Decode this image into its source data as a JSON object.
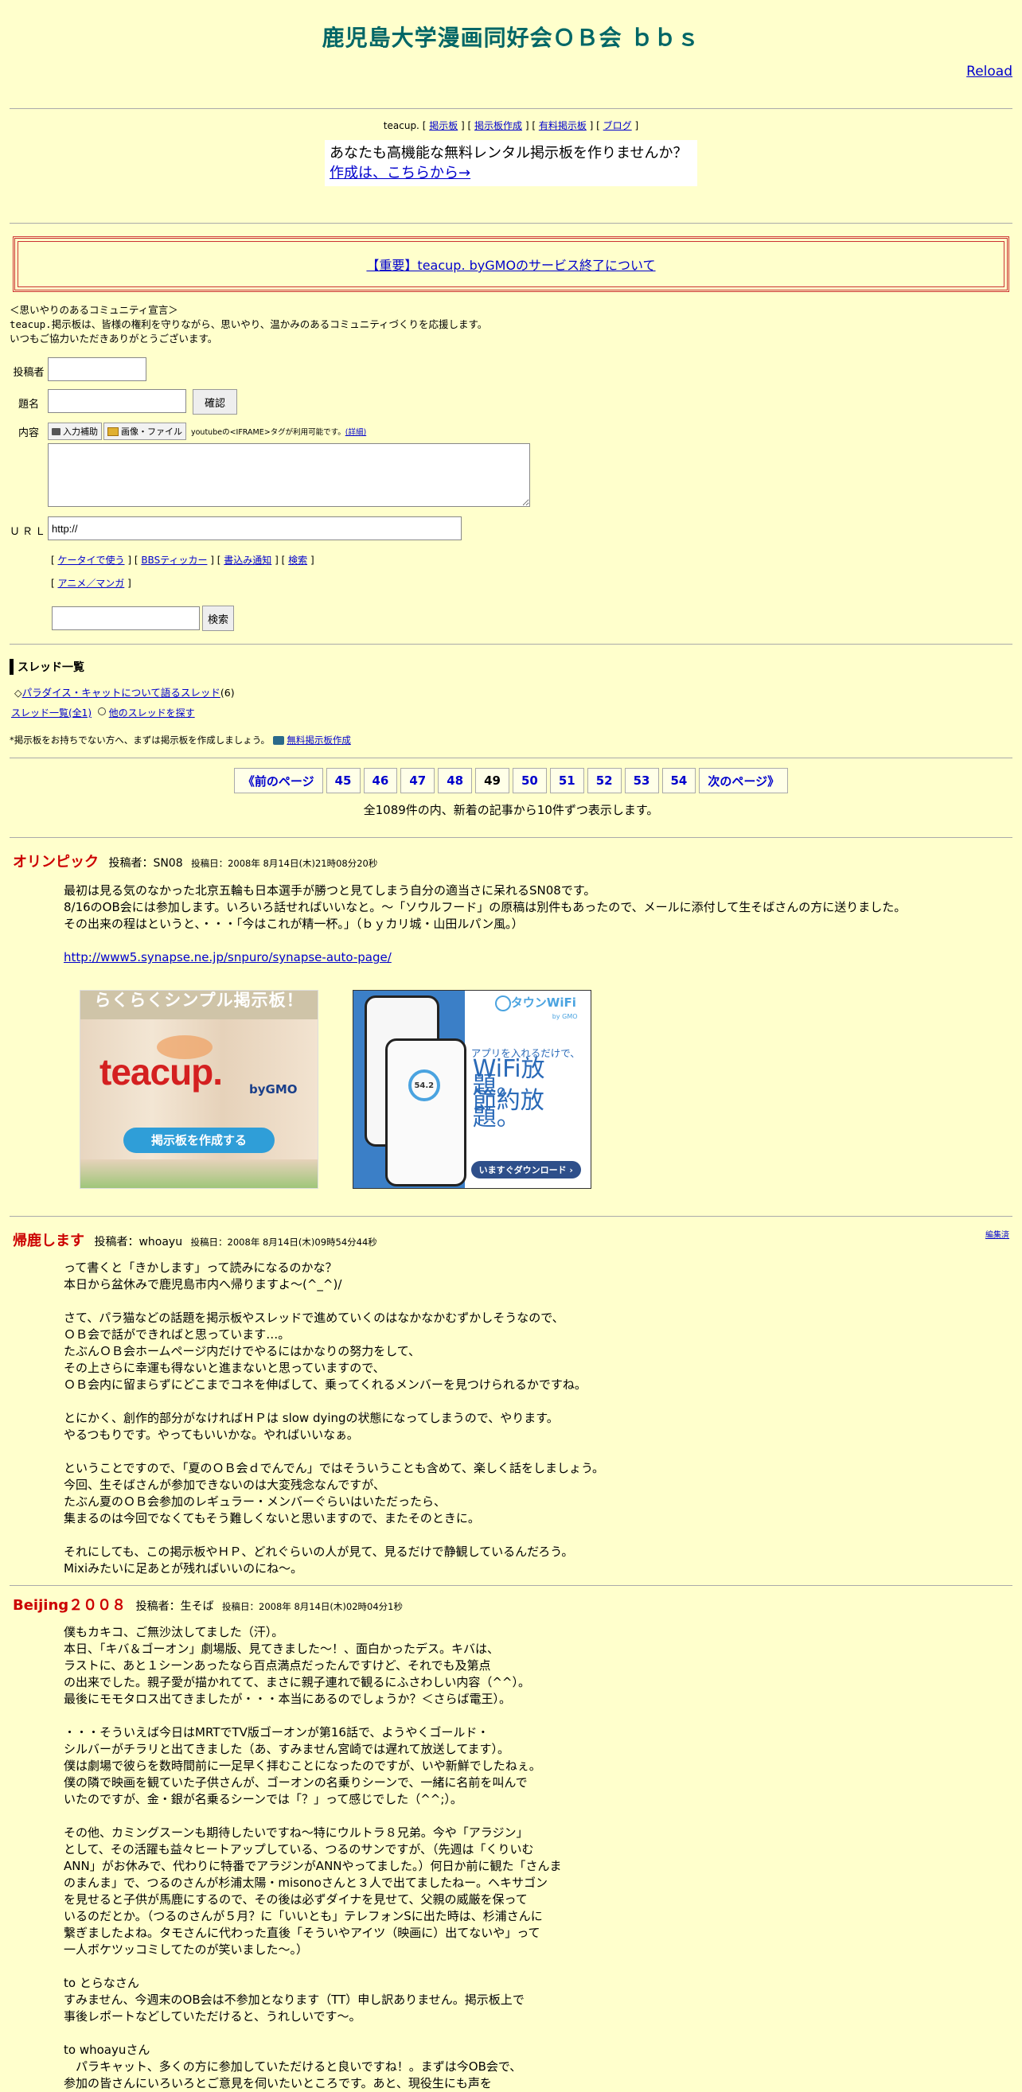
{
  "board": {
    "title": "鹿児島大学漫画同好会ＯＢ会 ｂｂｓ",
    "reload": "Reload"
  },
  "teacup_bar": {
    "prefix": "teacup.",
    "links": [
      "掲示板",
      "掲示板作成",
      "有料掲示板",
      "ブログ"
    ]
  },
  "ad": {
    "line1": "あなたも高機能な無料レンタル掲示板を作りませんか？",
    "link": "作成は、こちらから→"
  },
  "notice": "【重要】teacup. byGMOのサービス終了について",
  "declaration": {
    "line1": "＜思いやりのあるコミュニティ宣言＞",
    "brand": "teacup.",
    "line2": "掲示板は、皆様の権利を守りながら、思いやり、温かみのあるコミュニティづくりを応援します。",
    "line3": "いつもご協力いただきありがとうございます。"
  },
  "form": {
    "name_label": "投稿者",
    "subject_label": "題名",
    "confirm_button": "確認",
    "content_label": "内容",
    "input_assist": "入力補助",
    "image_file": "画像・ファイル",
    "youtube_note": "youtubeの<IFRAME>タグが利用可能です。",
    "detail_link": "(詳細)",
    "url_label": "ＵＲＬ",
    "url_value": "http://",
    "links": [
      "ケータイで使う",
      "BBSティッカー",
      "書込み通知",
      "検索"
    ],
    "genre": "アニメ／マンガ",
    "search_button": "検索"
  },
  "threads": {
    "heading": "スレッド一覧",
    "item_prefix": "◇",
    "item": "パラダイス・キャットについて語るスレッド",
    "item_count": "(6)",
    "all_link": "スレッド一覧(全1)",
    "other_link": "他のスレッドを探す",
    "promo_text": "*掲示板をお持ちでない方へ、まずは掲示板を作成しましょう。",
    "promo_link": "無料掲示板作成"
  },
  "pager": {
    "prev": "《前のページ",
    "pages": [
      "45",
      "46",
      "47",
      "48",
      "49",
      "50",
      "51",
      "52",
      "53",
      "54"
    ],
    "current": "49",
    "next": "次のページ》",
    "summary": "全1089件の内、新着の記事から10件ずつ表示します。"
  },
  "banners": {
    "teacup": {
      "headline": "らくらくシンプル掲示板！",
      "logo": "teacup.",
      "by": "byGMO",
      "button": "掲示板を作成する"
    },
    "wifi": {
      "brand": "タウンWiFi",
      "brand_sub": "by GMO",
      "tagline": "アプリを入れるだけで、",
      "main1": "WiFi放題。",
      "main2": "節約放題。",
      "button": "いますぐダウンロード ›",
      "phone_value": "54.2"
    }
  },
  "posts": [
    {
      "title": "オリンピック",
      "author": "投稿者：SN08",
      "date": "投稿日：2008年 8月14日(木)21時08分20秒",
      "paragraphs": [
        "最初は見る気のなかった北京五輪も日本選手が勝つと見てしまう自分の適当さに呆れるSN08です。\n8/16のOB会には参加します。いろいろ話せればいいなと。～「ソウルフード」の原稿は別件もあったので、メールに添付して生そばさんの方に送りました。\nその出来の程はというと、・・・「今はこれが精一杯。」（ｂｙカリ城・山田ルパン風。）"
      ],
      "link": "http://www5.synapse.ne.jp/snpuro/synapse-auto-page/"
    },
    {
      "title": "帰鹿します",
      "author": "投稿者：whoayu",
      "date": "投稿日：2008年 8月14日(木)09時54分44秒",
      "edit": "編集済",
      "paragraphs": [
        "って書くと「きかします」って読みになるのかな？\n本日から盆休みで鹿児島市内へ帰りますよ～(^_^)/",
        "さて、パラ猫などの話題を掲示板やスレッドで進めていくのはなかなかむずかしそうなので、\nＯＢ会で話ができればと思っています…。\nたぶんＯＢ会ホームページ内だけでやるにはかなりの努力をして、\nその上さらに幸運も得ないと進まないと思っていますので、\nＯＢ会内に留まらずにどこまでコネを伸ばして、乗ってくれるメンバーを見つけられるかですね。",
        "とにかく、創作的部分がなければＨＰは slow dyingの状態になってしまうので、やります。\nやるつもりです。やってもいいかな。やればいいなぁ。",
        "ということですので、「夏のＯＢ会ｄでんでん」ではそういうことも含めて、楽しく話をしましょう。\n今回、生そばさんが参加できないのは大変残念なんですが、\nたぶん夏のＯＢ会参加のレギュラー・メンバーぐらいはいただったら、\n集まるのは今回でなくてもそう難しくないと思いますので、またそのときに。",
        "それにしても、この掲示板やＨＰ、どれぐらいの人が見て、見るだけで静観しているんだろう。\nMixiみたいに足あとが残ればいいのにね～。"
      ]
    },
    {
      "title": "Beijing２００８",
      "author": "投稿者：生そば",
      "date": "投稿日：2008年 8月14日(木)02時04分1秒",
      "paragraphs": [
        "僕もカキコ、ご無沙汰してました（汗）。\n本日、「キバ＆ゴーオン」劇場版、見てきました～！、面白かったデス。キバは、\nラストに、あと１シーンあったなら百点満点だったんですけど、それでも及第点\nの出来でした。親子愛が描かれてて、まさに親子連れで観るにふさわしい内容（^^）。\n最後にモモタロス出てきましたが・・・本当にあるのでしょうか？＜さらば電王）。",
        "・・・そういえば今日はMRTでTV版ゴーオンが第16話で、ようやくゴールド・\nシルバーがチラリと出てきました（あ、すみません宮崎では遅れて放送してます）。\n僕は劇場で彼らを数時間前に一足早く拝むことになったのですが、いや新鮮でしたねぇ。\n僕の隣で映画を観ていた子供さんが、ゴーオンの名乗りシーンで、一緒に名前を叫んで\nいたのですが、金・銀が名乗るシーンでは「？」って感じでした（^^;）。",
        "その他、カミングスーンも期待したいですね～特にウルトラ８兄弟。今や「アラジン」\nとして、その活躍も益々ヒートアップしている、つるのサンですが、（先週は「くりいむ\nANN」がお休みで、代わりに特番でアラジンがANNやってました。）何日か前に観た「さんま\nのまんま」で、つるのさんが杉浦太陽・misonoさんと３人で出てましたねー。ヘキサゴン\nを見せると子供が馬鹿にするので、その後は必ずダイナを見せて、父親の威厳を保って\nいるのだとか。（つるのさんが５月？に「いいとも」テレフォンSに出た時は、杉浦さんに\n繋ぎましたよね。タモさんに代わった直後「そういやアイツ（映画に）出てないや」って\n一人ボケツッコミしてたのが笑いました～。）",
        "to とらなさん\nすみません、今週末のOB会は不参加となります（TT）申し訳ありません。掲示板上で\n事後レポートなどしていただけると、うれしいです～。",
        "to whoayuさん\n　パラキャット、多くの方に参加していただけると良いですね！。まずは今OB会で、\n参加の皆さんにいろいろとご意見を伺いたいところです。あと、現役生にも声を"
      ]
    }
  ]
}
